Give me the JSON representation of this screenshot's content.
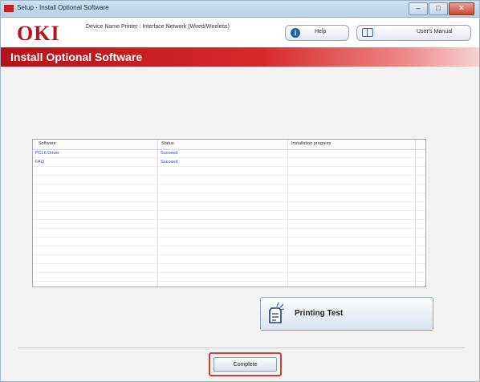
{
  "window": {
    "title": "Setup · Install Optional Software",
    "controls": {
      "minimize": "–",
      "maximize": "□",
      "close": "✕"
    }
  },
  "header": {
    "logo": "OKI",
    "device_info": "Device Name Printer : Interface Network (Wired/Wireless)",
    "help_label": "Help",
    "manual_label": "User's Manual"
  },
  "banner": {
    "title": "Install Optional Software"
  },
  "table": {
    "columns": [
      "Software",
      "Status",
      "Installation progress"
    ],
    "rows": [
      {
        "software": "PCL6 Driver",
        "status": "Succeed",
        "progress": ""
      },
      {
        "software": "FAQ",
        "status": "Succeed",
        "progress": ""
      }
    ]
  },
  "actions": {
    "printing_test_label": "Printing Test",
    "complete_label": "Complete"
  },
  "colors": {
    "brand_red": "#b5121b",
    "link_blue": "#1a47c8",
    "highlight_red": "#d63a3a"
  }
}
